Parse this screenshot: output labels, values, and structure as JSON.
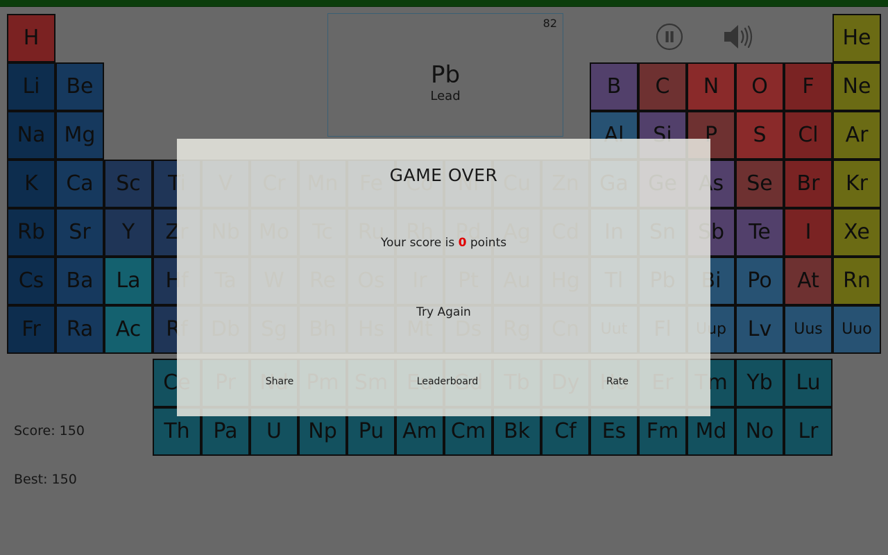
{
  "app": {
    "background_color": "#686868",
    "topbar_color": "#0b3d0b"
  },
  "question": {
    "atomic_number": "82",
    "symbol": "Pb",
    "name": "Lead"
  },
  "controls": {
    "pause_label": "pause-icon",
    "sound_label": "sound-on-icon"
  },
  "scoreboard": {
    "score": "Score: 150",
    "best": "Best: 150"
  },
  "modal": {
    "title": "GAME OVER",
    "score_prefix": "Your score is ",
    "score_value": "0",
    "score_suffix": " points",
    "retry": "Try Again",
    "share": "Share",
    "leaderboard": "Leaderboard",
    "rate": "Rate",
    "score_accent_color": "#e00000",
    "background_color": "rgba(233,233,225,0.86)"
  },
  "periodic_table": {
    "cell_size": 70,
    "categories": {
      "hydrogen": "#7b2222",
      "alkali": "#0d2d4e",
      "alkaline": "#16395e",
      "transition": "#1f3557",
      "lanthanide": "#14616f",
      "actinide": "#13515f",
      "post_transition": "#275273",
      "metalloid": "#52406b",
      "nonmetal": "#8a2a2a",
      "halogen": "#7a2323",
      "noble": "#6b6b14"
    },
    "elements": [
      {
        "sym": "H",
        "col": 1,
        "row": 1,
        "cat": "c-h"
      },
      {
        "sym": "He",
        "col": 18,
        "row": 1,
        "cat": "c-noble"
      },
      {
        "sym": "Li",
        "col": 1,
        "row": 2,
        "cat": "c-alkali"
      },
      {
        "sym": "Be",
        "col": 2,
        "row": 2,
        "cat": "c-alkaline"
      },
      {
        "sym": "B",
        "col": 13,
        "row": 2,
        "cat": "c-metalloid"
      },
      {
        "sym": "C",
        "col": 14,
        "row": 2,
        "cat": "c-nonmetal2"
      },
      {
        "sym": "N",
        "col": 15,
        "row": 2,
        "cat": "c-nonmetal"
      },
      {
        "sym": "O",
        "col": 16,
        "row": 2,
        "cat": "c-nonmetal"
      },
      {
        "sym": "F",
        "col": 17,
        "row": 2,
        "cat": "c-halogen"
      },
      {
        "sym": "Ne",
        "col": 18,
        "row": 2,
        "cat": "c-noble"
      },
      {
        "sym": "Na",
        "col": 1,
        "row": 3,
        "cat": "c-alkali"
      },
      {
        "sym": "Mg",
        "col": 2,
        "row": 3,
        "cat": "c-alkaline"
      },
      {
        "sym": "Al",
        "col": 13,
        "row": 3,
        "cat": "c-post"
      },
      {
        "sym": "Si",
        "col": 14,
        "row": 3,
        "cat": "c-metalloid"
      },
      {
        "sym": "P",
        "col": 15,
        "row": 3,
        "cat": "c-nonmetal2"
      },
      {
        "sym": "S",
        "col": 16,
        "row": 3,
        "cat": "c-nonmetal"
      },
      {
        "sym": "Cl",
        "col": 17,
        "row": 3,
        "cat": "c-halogen"
      },
      {
        "sym": "Ar",
        "col": 18,
        "row": 3,
        "cat": "c-noble"
      },
      {
        "sym": "K",
        "col": 1,
        "row": 4,
        "cat": "c-alkali"
      },
      {
        "sym": "Ca",
        "col": 2,
        "row": 4,
        "cat": "c-alkaline"
      },
      {
        "sym": "Sc",
        "col": 3,
        "row": 4,
        "cat": "c-trans"
      },
      {
        "sym": "Ti",
        "col": 4,
        "row": 4,
        "cat": "c-trans"
      },
      {
        "sym": "V",
        "col": 5,
        "row": 4,
        "cat": "c-trans"
      },
      {
        "sym": "Cr",
        "col": 6,
        "row": 4,
        "cat": "c-trans"
      },
      {
        "sym": "Mn",
        "col": 7,
        "row": 4,
        "cat": "c-trans"
      },
      {
        "sym": "Fe",
        "col": 8,
        "row": 4,
        "cat": "c-trans"
      },
      {
        "sym": "Co",
        "col": 9,
        "row": 4,
        "cat": "c-trans"
      },
      {
        "sym": "Ni",
        "col": 10,
        "row": 4,
        "cat": "c-trans"
      },
      {
        "sym": "Cu",
        "col": 11,
        "row": 4,
        "cat": "c-trans"
      },
      {
        "sym": "Zn",
        "col": 12,
        "row": 4,
        "cat": "c-trans"
      },
      {
        "sym": "Ga",
        "col": 13,
        "row": 4,
        "cat": "c-post"
      },
      {
        "sym": "Ge",
        "col": 14,
        "row": 4,
        "cat": "c-metalloid"
      },
      {
        "sym": "As",
        "col": 15,
        "row": 4,
        "cat": "c-metalloid"
      },
      {
        "sym": "Se",
        "col": 16,
        "row": 4,
        "cat": "c-nonmetal2"
      },
      {
        "sym": "Br",
        "col": 17,
        "row": 4,
        "cat": "c-halogen"
      },
      {
        "sym": "Kr",
        "col": 18,
        "row": 4,
        "cat": "c-noble"
      },
      {
        "sym": "Rb",
        "col": 1,
        "row": 5,
        "cat": "c-alkali"
      },
      {
        "sym": "Sr",
        "col": 2,
        "row": 5,
        "cat": "c-alkaline"
      },
      {
        "sym": "Y",
        "col": 3,
        "row": 5,
        "cat": "c-trans"
      },
      {
        "sym": "Zr",
        "col": 4,
        "row": 5,
        "cat": "c-trans"
      },
      {
        "sym": "Nb",
        "col": 5,
        "row": 5,
        "cat": "c-trans"
      },
      {
        "sym": "Mo",
        "col": 6,
        "row": 5,
        "cat": "c-trans"
      },
      {
        "sym": "Tc",
        "col": 7,
        "row": 5,
        "cat": "c-trans"
      },
      {
        "sym": "Ru",
        "col": 8,
        "row": 5,
        "cat": "c-trans"
      },
      {
        "sym": "Rh",
        "col": 9,
        "row": 5,
        "cat": "c-trans"
      },
      {
        "sym": "Pd",
        "col": 10,
        "row": 5,
        "cat": "c-trans"
      },
      {
        "sym": "Ag",
        "col": 11,
        "row": 5,
        "cat": "c-trans"
      },
      {
        "sym": "Cd",
        "col": 12,
        "row": 5,
        "cat": "c-trans"
      },
      {
        "sym": "In",
        "col": 13,
        "row": 5,
        "cat": "c-post"
      },
      {
        "sym": "Sn",
        "col": 14,
        "row": 5,
        "cat": "c-post"
      },
      {
        "sym": "Sb",
        "col": 15,
        "row": 5,
        "cat": "c-metalloid"
      },
      {
        "sym": "Te",
        "col": 16,
        "row": 5,
        "cat": "c-metalloid"
      },
      {
        "sym": "I",
        "col": 17,
        "row": 5,
        "cat": "c-halogen"
      },
      {
        "sym": "Xe",
        "col": 18,
        "row": 5,
        "cat": "c-noble"
      },
      {
        "sym": "Cs",
        "col": 1,
        "row": 6,
        "cat": "c-alkali"
      },
      {
        "sym": "Ba",
        "col": 2,
        "row": 6,
        "cat": "c-alkaline"
      },
      {
        "sym": "La",
        "col": 3,
        "row": 6,
        "cat": "c-lanth"
      },
      {
        "sym": "Hf",
        "col": 4,
        "row": 6,
        "cat": "c-trans"
      },
      {
        "sym": "Ta",
        "col": 5,
        "row": 6,
        "cat": "c-trans"
      },
      {
        "sym": "W",
        "col": 6,
        "row": 6,
        "cat": "c-trans"
      },
      {
        "sym": "Re",
        "col": 7,
        "row": 6,
        "cat": "c-trans"
      },
      {
        "sym": "Os",
        "col": 8,
        "row": 6,
        "cat": "c-trans"
      },
      {
        "sym": "Ir",
        "col": 9,
        "row": 6,
        "cat": "c-trans"
      },
      {
        "sym": "Pt",
        "col": 10,
        "row": 6,
        "cat": "c-trans"
      },
      {
        "sym": "Au",
        "col": 11,
        "row": 6,
        "cat": "c-trans"
      },
      {
        "sym": "Hg",
        "col": 12,
        "row": 6,
        "cat": "c-trans"
      },
      {
        "sym": "Tl",
        "col": 13,
        "row": 6,
        "cat": "c-post"
      },
      {
        "sym": "Pb",
        "col": 14,
        "row": 6,
        "cat": "c-post"
      },
      {
        "sym": "Bi",
        "col": 15,
        "row": 6,
        "cat": "c-post"
      },
      {
        "sym": "Po",
        "col": 16,
        "row": 6,
        "cat": "c-post"
      },
      {
        "sym": "At",
        "col": 17,
        "row": 6,
        "cat": "c-nonmetal2"
      },
      {
        "sym": "Rn",
        "col": 18,
        "row": 6,
        "cat": "c-noble"
      },
      {
        "sym": "Fr",
        "col": 1,
        "row": 7,
        "cat": "c-alkali"
      },
      {
        "sym": "Ra",
        "col": 2,
        "row": 7,
        "cat": "c-alkaline"
      },
      {
        "sym": "Ac",
        "col": 3,
        "row": 7,
        "cat": "c-lanth"
      },
      {
        "sym": "Rf",
        "col": 4,
        "row": 7,
        "cat": "c-trans"
      },
      {
        "sym": "Db",
        "col": 5,
        "row": 7,
        "cat": "c-trans"
      },
      {
        "sym": "Sg",
        "col": 6,
        "row": 7,
        "cat": "c-trans"
      },
      {
        "sym": "Bh",
        "col": 7,
        "row": 7,
        "cat": "c-trans"
      },
      {
        "sym": "Hs",
        "col": 8,
        "row": 7,
        "cat": "c-trans"
      },
      {
        "sym": "Mt",
        "col": 9,
        "row": 7,
        "cat": "c-trans"
      },
      {
        "sym": "Ds",
        "col": 10,
        "row": 7,
        "cat": "c-trans"
      },
      {
        "sym": "Rg",
        "col": 11,
        "row": 7,
        "cat": "c-trans"
      },
      {
        "sym": "Cn",
        "col": 12,
        "row": 7,
        "cat": "c-trans"
      },
      {
        "sym": "Uut",
        "col": 13,
        "row": 7,
        "cat": "c-post",
        "size": "tiny"
      },
      {
        "sym": "Fl",
        "col": 14,
        "row": 7,
        "cat": "c-post"
      },
      {
        "sym": "Uup",
        "col": 15,
        "row": 7,
        "cat": "c-post",
        "size": "tiny"
      },
      {
        "sym": "Lv",
        "col": 16,
        "row": 7,
        "cat": "c-post"
      },
      {
        "sym": "Uus",
        "col": 17,
        "row": 7,
        "cat": "c-post",
        "size": "tiny"
      },
      {
        "sym": "Uuo",
        "col": 18,
        "row": 7,
        "cat": "c-post",
        "size": "tiny"
      },
      {
        "sym": "Ce",
        "col": 4,
        "row": 8.1,
        "cat": "c-actin"
      },
      {
        "sym": "Pr",
        "col": 5,
        "row": 8.1,
        "cat": "c-actin"
      },
      {
        "sym": "Nd",
        "col": 6,
        "row": 8.1,
        "cat": "c-actin"
      },
      {
        "sym": "Pm",
        "col": 7,
        "row": 8.1,
        "cat": "c-actin"
      },
      {
        "sym": "Sm",
        "col": 8,
        "row": 8.1,
        "cat": "c-actin"
      },
      {
        "sym": "Eu",
        "col": 9,
        "row": 8.1,
        "cat": "c-actin"
      },
      {
        "sym": "Gd",
        "col": 10,
        "row": 8.1,
        "cat": "c-actin"
      },
      {
        "sym": "Tb",
        "col": 11,
        "row": 8.1,
        "cat": "c-actin"
      },
      {
        "sym": "Dy",
        "col": 12,
        "row": 8.1,
        "cat": "c-actin"
      },
      {
        "sym": "Ho",
        "col": 13,
        "row": 8.1,
        "cat": "c-actin"
      },
      {
        "sym": "Er",
        "col": 14,
        "row": 8.1,
        "cat": "c-actin"
      },
      {
        "sym": "Tm",
        "col": 15,
        "row": 8.1,
        "cat": "c-actin"
      },
      {
        "sym": "Yb",
        "col": 16,
        "row": 8.1,
        "cat": "c-actin"
      },
      {
        "sym": "Lu",
        "col": 17,
        "row": 8.1,
        "cat": "c-actin"
      },
      {
        "sym": "Th",
        "col": 4,
        "row": 9.1,
        "cat": "c-actin"
      },
      {
        "sym": "Pa",
        "col": 5,
        "row": 9.1,
        "cat": "c-actin"
      },
      {
        "sym": "U",
        "col": 6,
        "row": 9.1,
        "cat": "c-actin"
      },
      {
        "sym": "Np",
        "col": 7,
        "row": 9.1,
        "cat": "c-actin"
      },
      {
        "sym": "Pu",
        "col": 8,
        "row": 9.1,
        "cat": "c-actin"
      },
      {
        "sym": "Am",
        "col": 9,
        "row": 9.1,
        "cat": "c-actin"
      },
      {
        "sym": "Cm",
        "col": 10,
        "row": 9.1,
        "cat": "c-actin"
      },
      {
        "sym": "Bk",
        "col": 11,
        "row": 9.1,
        "cat": "c-actin"
      },
      {
        "sym": "Cf",
        "col": 12,
        "row": 9.1,
        "cat": "c-actin"
      },
      {
        "sym": "Es",
        "col": 13,
        "row": 9.1,
        "cat": "c-actin"
      },
      {
        "sym": "Fm",
        "col": 14,
        "row": 9.1,
        "cat": "c-actin"
      },
      {
        "sym": "Md",
        "col": 15,
        "row": 9.1,
        "cat": "c-actin"
      },
      {
        "sym": "No",
        "col": 16,
        "row": 9.1,
        "cat": "c-actin"
      },
      {
        "sym": "Lr",
        "col": 17,
        "row": 9.1,
        "cat": "c-actin"
      }
    ]
  }
}
